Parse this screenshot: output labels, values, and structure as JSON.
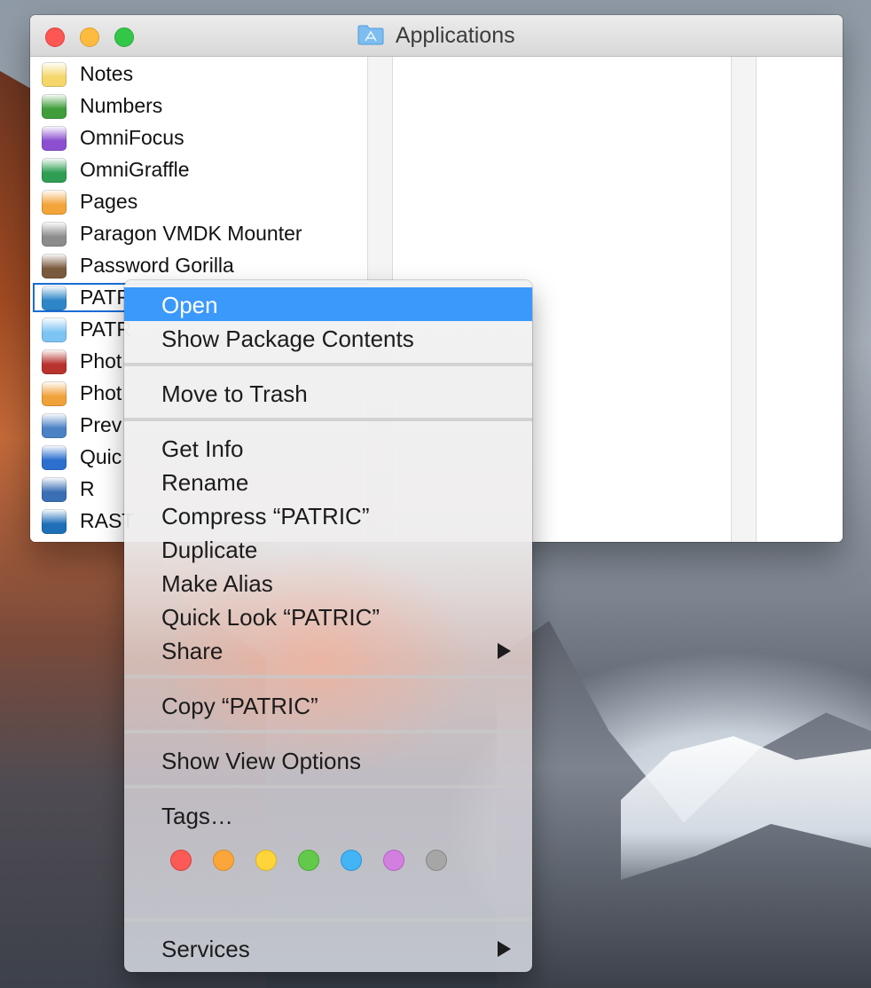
{
  "window": {
    "title": "Applications"
  },
  "files": [
    {
      "name": "Notes",
      "icon": "notes-icon",
      "color": "#f5d66b"
    },
    {
      "name": "Numbers",
      "icon": "numbers-icon",
      "color": "#3f9e3a"
    },
    {
      "name": "OmniFocus",
      "icon": "omnifocus-icon",
      "color": "#8b4fd0"
    },
    {
      "name": "OmniGraffle",
      "icon": "omnigraffle-icon",
      "color": "#2f9e54"
    },
    {
      "name": "Pages",
      "icon": "pages-icon",
      "color": "#f3a43a"
    },
    {
      "name": "Paragon VMDK Mounter",
      "icon": "paragon-icon",
      "color": "#8c8c8c"
    },
    {
      "name": "Password Gorilla",
      "icon": "gorilla-icon",
      "color": "#7a5a3e"
    },
    {
      "name": "PATRIC",
      "icon": "patric-app-icon",
      "color": "#2e86c7",
      "selected": true
    },
    {
      "name": "PATR",
      "icon": "folder-icon",
      "color": "#7cc4f3"
    },
    {
      "name": "Phot",
      "icon": "photo-booth-icon",
      "color": "#b8332e"
    },
    {
      "name": "Phot",
      "icon": "photos-icon",
      "color": "#f0a23a"
    },
    {
      "name": "Prev",
      "icon": "preview-icon",
      "color": "#4b82c5"
    },
    {
      "name": "Quic",
      "icon": "quicktime-icon",
      "color": "#2c6fcf"
    },
    {
      "name": "R",
      "icon": "r-icon",
      "color": "#3a6fb5"
    },
    {
      "name": "RAST",
      "icon": "kbase-icon",
      "color": "#1e6fb8"
    }
  ],
  "context_menu": {
    "open": "Open",
    "show_package_contents": "Show Package Contents",
    "move_to_trash": "Move to Trash",
    "get_info": "Get Info",
    "rename": "Rename",
    "compress": "Compress “PATRIC”",
    "duplicate": "Duplicate",
    "make_alias": "Make Alias",
    "quick_look": "Quick Look “PATRIC”",
    "share": "Share",
    "copy": "Copy “PATRIC”",
    "show_view_options": "Show View Options",
    "tags": "Tags…",
    "services": "Services",
    "tag_colors": [
      {
        "name": "red",
        "fill": "#fb5a56",
        "stroke": "#d9403c"
      },
      {
        "name": "orange",
        "fill": "#fba53b",
        "stroke": "#df8a22"
      },
      {
        "name": "yellow",
        "fill": "#fdd43a",
        "stroke": "#dcb323"
      },
      {
        "name": "green",
        "fill": "#63c94a",
        "stroke": "#48ab31"
      },
      {
        "name": "blue",
        "fill": "#43b4f5",
        "stroke": "#2a96d6"
      },
      {
        "name": "purple",
        "fill": "#d27fdf",
        "stroke": "#b564c2"
      },
      {
        "name": "gray",
        "fill": "#a6a6a6",
        "stroke": "#888888"
      }
    ]
  }
}
